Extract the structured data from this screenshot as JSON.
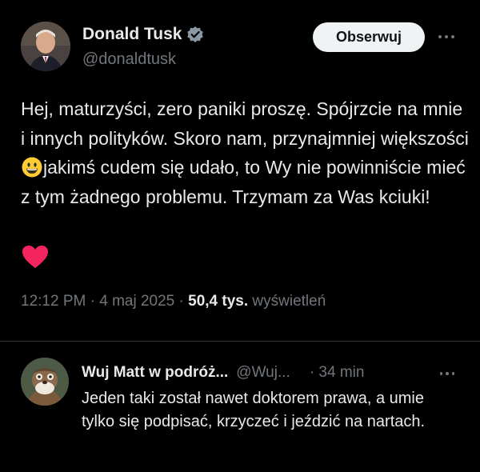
{
  "tweet": {
    "author_name": "Donald Tusk",
    "author_handle": "@donaldtusk",
    "follow_label": "Obserwuj",
    "text_part1": "Hej, maturzyści, zero paniki proszę. Spójrzcie na mnie i innych polityków. Skoro nam, przynajmniej większości",
    "text_part2": "jakimś cudem się udało, to Wy nie powinniście mieć z tym żadnego problemu. Trzymam za Was kciuki!",
    "time": "12:12 PM",
    "date": "4 maj 2025",
    "views_count": "50,4 tys.",
    "views_label": "wyświetleń",
    "separator": "·",
    "verified_color": "#8b98a5",
    "heart_color": "#f4245e",
    "emoji": "grinning-face-emoji"
  },
  "reply": {
    "author_name": "Wuj Matt w podróż...",
    "author_handle": "@Wuj...",
    "time": "· 34 min",
    "text": "Jeden taki został nawet doktorem prawa, a umie tylko się podpisać, krzyczeć i jeździć na nartach."
  },
  "colors": {
    "background": "#000000",
    "text": "#e7e9ea",
    "secondary_text": "#71767b",
    "follow_button_bg": "#eff3f4",
    "divider": "#2f3336"
  }
}
